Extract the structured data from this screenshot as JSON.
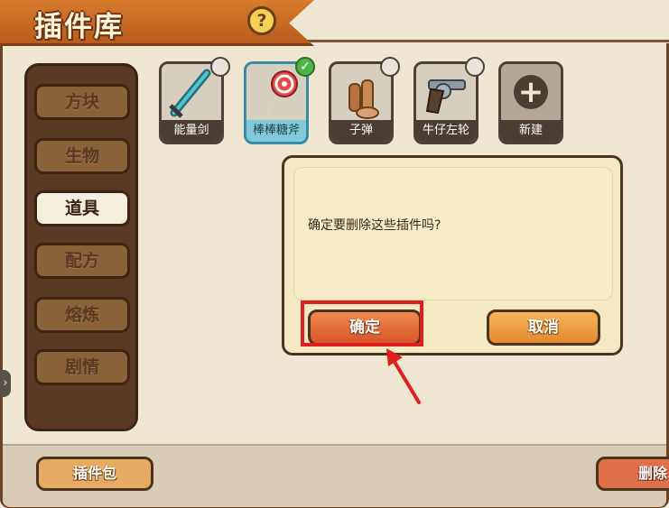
{
  "header": {
    "title": "插件库",
    "help_label": "?"
  },
  "sidebar": {
    "items": [
      {
        "label": "方块"
      },
      {
        "label": "生物"
      },
      {
        "label": "道具"
      },
      {
        "label": "配方"
      },
      {
        "label": "熔炼"
      },
      {
        "label": "剧情"
      }
    ],
    "active": "道具"
  },
  "plugins": [
    {
      "label": "能量剑",
      "selected": false
    },
    {
      "label": "棒棒糖斧",
      "selected": true
    },
    {
      "label": "子弹",
      "selected": false
    },
    {
      "label": "牛仔左轮",
      "selected": false
    }
  ],
  "new_tile": {
    "label": "新建"
  },
  "dialog": {
    "message": "确定要删除这些插件吗?",
    "confirm_label": "确定",
    "cancel_label": "取消"
  },
  "footer": {
    "pack_label": "插件包",
    "delete_label": "删除"
  },
  "colors": {
    "highlight": "#e01e1e",
    "accent": "#d9552a",
    "selected_check": "#4fb548"
  }
}
